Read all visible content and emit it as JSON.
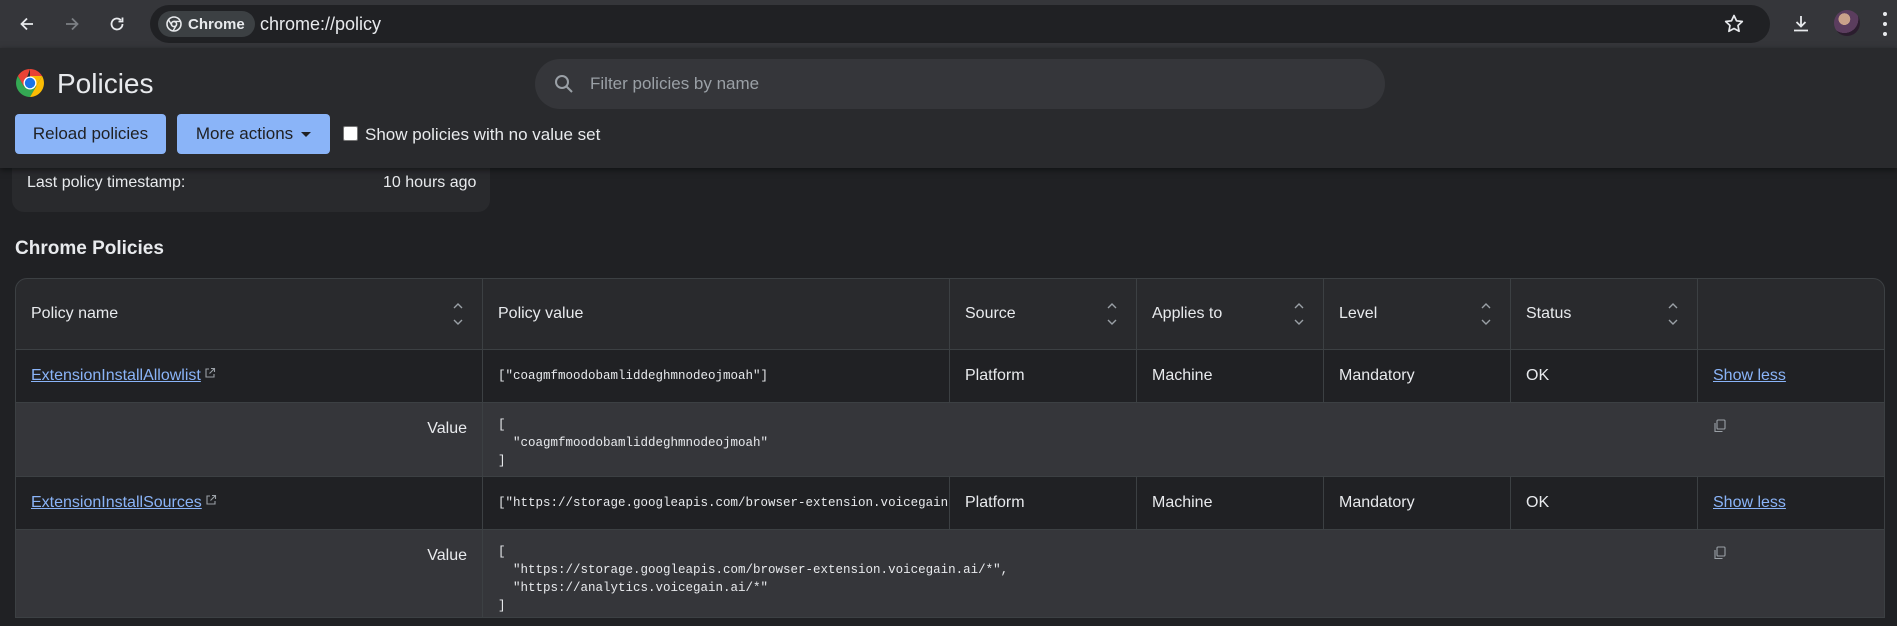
{
  "browser": {
    "chip_label": "Chrome",
    "url": "chrome://policy"
  },
  "header": {
    "title": "Policies",
    "search_placeholder": "Filter policies by name",
    "reload_label": "Reload policies",
    "more_actions_label": "More actions",
    "show_unset_label": "Show policies with no value set",
    "show_unset_checked": false
  },
  "status": {
    "timestamp_label": "Last policy timestamp:",
    "timestamp_value": "10 hours ago"
  },
  "section": {
    "title": "Chrome Policies"
  },
  "table": {
    "columns": [
      "Policy name",
      "Policy value",
      "Source",
      "Applies to",
      "Level",
      "Status"
    ],
    "rows": [
      {
        "name": "ExtensionInstallAllowlist",
        "value": "[\"coagmfmoodobamliddeghmnodeojmoah\"]",
        "source": "Platform",
        "applies_to": "Machine",
        "level": "Mandatory",
        "status": "OK",
        "toggle_label": "Show less",
        "detail_label": "Value",
        "detail_value": "[\n  \"coagmfmoodobamliddeghmnodeojmoah\"\n]"
      },
      {
        "name": "ExtensionInstallSources",
        "value": "[\"https://storage.googleapis.com/browser-extension.voicegain.ai/*\",\"https://analytics.voicegain.ai/*\"]",
        "source": "Platform",
        "applies_to": "Machine",
        "level": "Mandatory",
        "status": "OK",
        "toggle_label": "Show less",
        "detail_label": "Value",
        "detail_value": "[\n  \"https://storage.googleapis.com/browser-extension.voicegain.ai/*\",\n  \"https://analytics.voicegain.ai/*\"\n]"
      }
    ]
  },
  "colors": {
    "accent": "#8ab4f8",
    "page_bg": "#202124",
    "header_bg": "#292a2d",
    "detail_bg": "#35363a"
  }
}
